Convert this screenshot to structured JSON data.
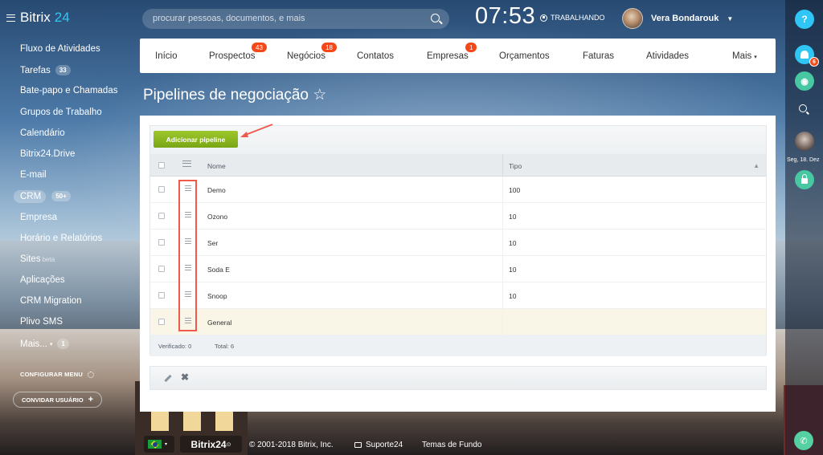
{
  "header": {
    "logo_prefix": "Bitrix",
    "logo_suffix": "24",
    "search_placeholder": "procurar pessoas, documentos, e mais",
    "clock": "07:53",
    "work_status": "TRABALHANDO",
    "user_name": "Vera Bondarouk"
  },
  "sidebar": {
    "items": [
      {
        "label": "Fluxo de Atividades"
      },
      {
        "label": "Tarefas",
        "counter": "33"
      },
      {
        "label": "Bate-papo e Chamadas"
      },
      {
        "label": "Grupos de Trabalho"
      },
      {
        "label": "Calendário"
      },
      {
        "label": "Bitrix24.Drive"
      },
      {
        "label": "E-mail"
      },
      {
        "label": "CRM",
        "counter": "50+"
      },
      {
        "label": "Empresa"
      },
      {
        "label": "Horário e Relatórios"
      },
      {
        "label": "Sites",
        "sup": "beta"
      },
      {
        "label": "Aplicações"
      },
      {
        "label": "CRM Migration"
      },
      {
        "label": "Plivo SMS"
      },
      {
        "label": "Mais...",
        "counter": "1"
      }
    ],
    "configure_menu": "CONFIGURAR MENU",
    "invite_user": "CONVIDAR USUÁRIO"
  },
  "tabs": [
    {
      "label": "Início"
    },
    {
      "label": "Prospectos",
      "badge": "43"
    },
    {
      "label": "Negócios",
      "badge": "18"
    },
    {
      "label": "Contatos"
    },
    {
      "label": "Empresas",
      "badge": "1"
    },
    {
      "label": "Orçamentos"
    },
    {
      "label": "Faturas"
    },
    {
      "label": "Atividades"
    },
    {
      "label": "Mais"
    }
  ],
  "page": {
    "title": "Pipelines de negociação",
    "star": "☆"
  },
  "grid": {
    "add_button": "Adicionar pipeline",
    "columns": [
      "Nome",
      "Tipo"
    ],
    "rows": [
      {
        "name": "Demo",
        "tipo": "100"
      },
      {
        "name": "Ozono",
        "tipo": "10"
      },
      {
        "name": "Ser",
        "tipo": "10"
      },
      {
        "name": "Soda E",
        "tipo": "10"
      },
      {
        "name": "Snoop",
        "tipo": "10"
      },
      {
        "name": "General",
        "tipo": ""
      }
    ],
    "checked": "Verificado: 0",
    "total": "Total: 6"
  },
  "rail": {
    "help": "?",
    "notif_count": "6",
    "date": "Seg, 18. Dez"
  },
  "footer": {
    "copyright": "© 2001-2018 Bitrix, Inc.",
    "support": "Suporte24",
    "themes": "Temas de Fundo",
    "logo": "Bitrix24"
  },
  "colors": {
    "accent": "#2fc6f6",
    "badge": "#f54819",
    "add_button": "#7aa615",
    "highlight": "#f05a4d"
  }
}
